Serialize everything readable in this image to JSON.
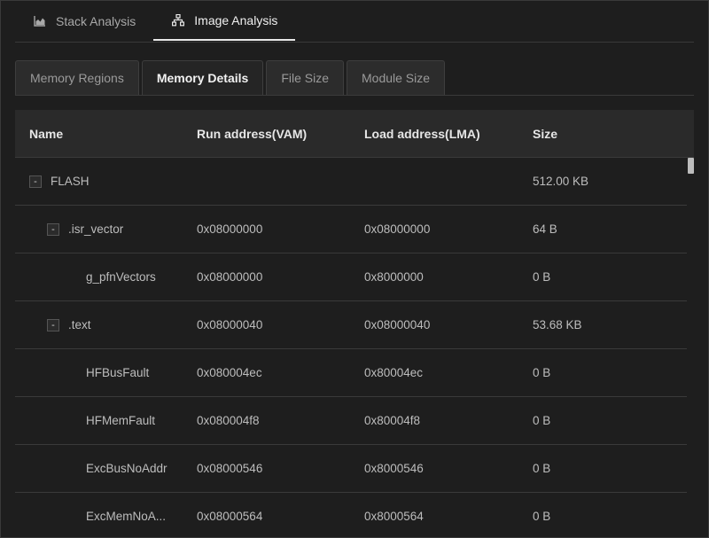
{
  "top_tabs": [
    {
      "label": "Stack Analysis",
      "icon": "area-chart-icon",
      "active": false
    },
    {
      "label": "Image Analysis",
      "icon": "hierarchy-icon",
      "active": true
    }
  ],
  "sub_tabs": [
    {
      "label": "Memory Regions",
      "active": false
    },
    {
      "label": "Memory Details",
      "active": true
    },
    {
      "label": "File Size",
      "active": false
    },
    {
      "label": "Module Size",
      "active": false
    }
  ],
  "table": {
    "columns": [
      "Name",
      "Run address(VAM)",
      "Load address(LMA)",
      "Size"
    ],
    "rows": [
      {
        "level": 0,
        "toggle": "-",
        "name": "FLASH",
        "vma": "",
        "lma": "",
        "size": "512.00 KB"
      },
      {
        "level": 1,
        "toggle": "-",
        "name": ".isr_vector",
        "vma": "0x08000000",
        "lma": "0x08000000",
        "size": "64 B"
      },
      {
        "level": 2,
        "toggle": "",
        "name": "g_pfnVectors",
        "vma": "0x08000000",
        "lma": "0x8000000",
        "size": "0 B"
      },
      {
        "level": 1,
        "toggle": "-",
        "name": ".text",
        "vma": "0x08000040",
        "lma": "0x08000040",
        "size": "53.68 KB"
      },
      {
        "level": 2,
        "toggle": "",
        "name": "HFBusFault",
        "vma": "0x080004ec",
        "lma": "0x80004ec",
        "size": "0 B"
      },
      {
        "level": 2,
        "toggle": "",
        "name": "HFMemFault",
        "vma": "0x080004f8",
        "lma": "0x80004f8",
        "size": "0 B"
      },
      {
        "level": 2,
        "toggle": "",
        "name": "ExcBusNoAddr",
        "vma": "0x08000546",
        "lma": "0x8000546",
        "size": "0 B"
      },
      {
        "level": 2,
        "toggle": "",
        "name": "ExcMemNoA...",
        "vma": "0x08000564",
        "lma": "0x8000564",
        "size": "0 B"
      }
    ]
  },
  "colors": {
    "background": "#1e1e1e",
    "header": "#2a2a2a",
    "border": "#3a3a3a"
  }
}
